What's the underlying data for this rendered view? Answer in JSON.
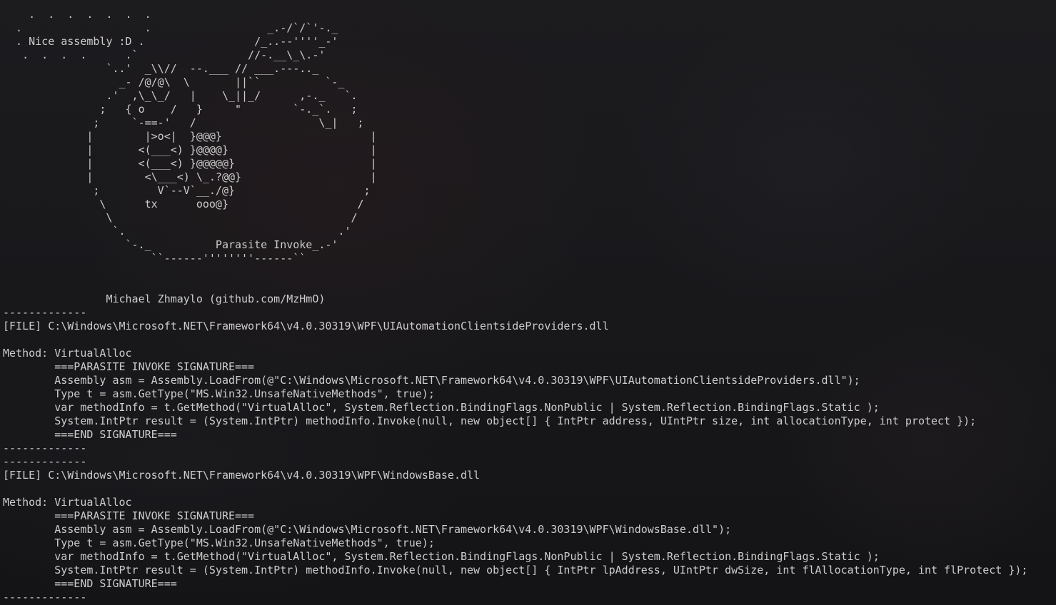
{
  "terminal": {
    "lines": [
      "    .  .  .  .  .  .  .",
      "  .                   .                  _.-/`/`'-._",
      "  . Nice assembly :D .                 /_..--''''_-'",
      "   .  .  .  .      .`                 //-.__\\_\\.-'",
      "                `..'  _\\\\//  --.___ // ___.---.._",
      "                  _- /@/@\\  \\       ||``          `-_",
      "                .'  ,\\_\\_/   |    \\_||_/      ,-._   `.",
      "               ;   { o    /   }     \"        `-._`.   ;",
      "              ;     `-==-'   /                   \\_|   ;",
      "             |        |>o<|  }@@@}                       |",
      "             |       <(___<) }@@@@}                      |",
      "             |       <(___<) }@@@@@}                     |",
      "             |        <\\___<) \\_.?@@}                    |",
      "              ;         V`--V`__./@}                    ;",
      "               \\      tx      ooo@}                    /",
      "                \\                                     /",
      "                 `.                                 .'",
      "                   `-._          Parasite Invoke_.-'",
      "                       ``------''''''''------``",
      "",
      "",
      "                Michael Zhmaylo (github.com/MzHmO)",
      "-------------",
      "[FILE] C:\\Windows\\Microsoft.NET\\Framework64\\v4.0.30319\\WPF\\UIAutomationClientsideProviders.dll",
      "",
      "Method: VirtualAlloc",
      "        ===PARASITE INVOKE SIGNATURE===",
      "        Assembly asm = Assembly.LoadFrom(@\"C:\\Windows\\Microsoft.NET\\Framework64\\v4.0.30319\\WPF\\UIAutomationClientsideProviders.dll\");",
      "        Type t = asm.GetType(\"MS.Win32.UnsafeNativeMethods\", true);",
      "        var methodInfo = t.GetMethod(\"VirtualAlloc\", System.Reflection.BindingFlags.NonPublic | System.Reflection.BindingFlags.Static );",
      "        System.IntPtr result = (System.IntPtr) methodInfo.Invoke(null, new object[] { IntPtr address, UIntPtr size, int allocationType, int protect });",
      "        ===END SIGNATURE===",
      "-------------",
      "-------------",
      "[FILE] C:\\Windows\\Microsoft.NET\\Framework64\\v4.0.30319\\WPF\\WindowsBase.dll",
      "",
      "Method: VirtualAlloc",
      "        ===PARASITE INVOKE SIGNATURE===",
      "        Assembly asm = Assembly.LoadFrom(@\"C:\\Windows\\Microsoft.NET\\Framework64\\v4.0.30319\\WPF\\WindowsBase.dll\");",
      "        Type t = asm.GetType(\"MS.Win32.UnsafeNativeMethods\", true);",
      "        var methodInfo = t.GetMethod(\"VirtualAlloc\", System.Reflection.BindingFlags.NonPublic | System.Reflection.BindingFlags.Static );",
      "        System.IntPtr result = (System.IntPtr) methodInfo.Invoke(null, new object[] { IntPtr lpAddress, UIntPtr dwSize, int flAllocationType, int flProtect });",
      "        ===END SIGNATURE===",
      "-------------"
    ]
  }
}
